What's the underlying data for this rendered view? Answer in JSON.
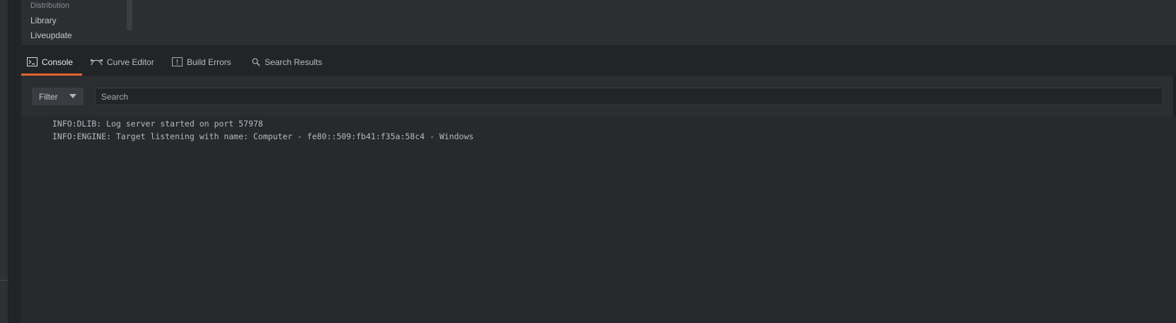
{
  "outline": {
    "items": [
      {
        "label": "Distribution"
      },
      {
        "label": "Library"
      },
      {
        "label": "Liveupdate"
      }
    ]
  },
  "tabs": [
    {
      "label": "Console",
      "icon": "terminal-icon",
      "active": true
    },
    {
      "label": "Curve Editor",
      "icon": "curve-icon",
      "active": false
    },
    {
      "label": "Build Errors",
      "icon": "error-box-icon",
      "active": false
    },
    {
      "label": "Search Results",
      "icon": "magnifier-icon",
      "active": false
    }
  ],
  "console": {
    "filter_label": "Filter",
    "search_placeholder": "Search",
    "log": [
      "INFO:DLIB: Log server started on port 57978",
      "INFO:ENGINE: Target listening with name: Computer - fe80::509:fb41:f35a:58c4 - Windows"
    ]
  },
  "colors": {
    "accent": "#e5642e",
    "background": "#27292d",
    "panel": "#2c2e32",
    "text": "#b6b9be"
  }
}
